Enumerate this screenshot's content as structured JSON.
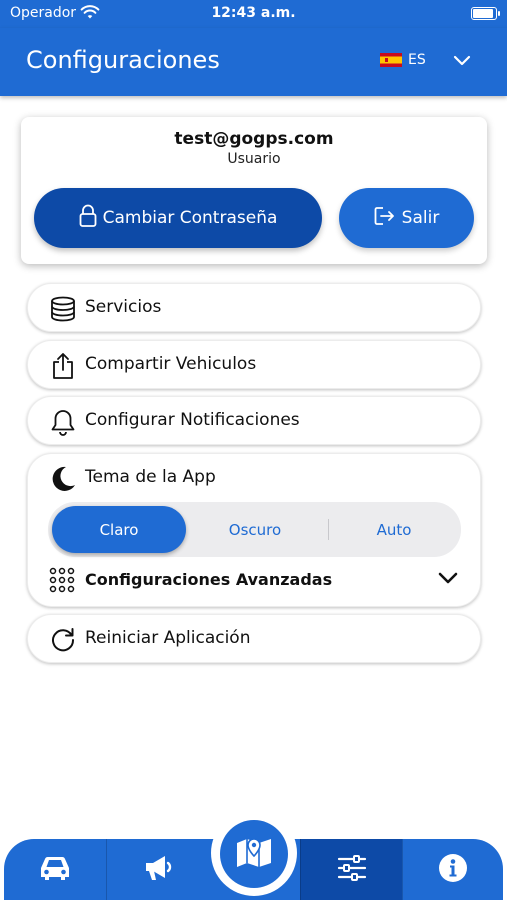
{
  "status_bar": {
    "carrier": "Operador",
    "time": "12:43 a.m."
  },
  "header": {
    "title": "Configuraciones",
    "language": "ES"
  },
  "user": {
    "email": "test@gogps.com",
    "role": "Usuario",
    "change_password_label": "Cambiar Contraseña",
    "logout_label": "Salir"
  },
  "menu": {
    "services": "Servicios",
    "share_vehicles": "Compartir Vehiculos",
    "notifications": "Configurar Notificaciones",
    "restart": "Reiniciar Aplicación"
  },
  "theme": {
    "label": "Tema de la App",
    "options": [
      "Claro",
      "Oscuro",
      "Auto"
    ],
    "selected": "Claro"
  },
  "advanced": {
    "label": "Configuraciones Avanzadas"
  },
  "colors": {
    "primary": "#1f6bd3",
    "primary_dark": "#0d4aa7"
  },
  "bottom_nav": {
    "items": [
      "car-icon",
      "megaphone-icon",
      "map-icon",
      "sliders-icon",
      "info-icon"
    ],
    "active": "sliders-icon"
  }
}
